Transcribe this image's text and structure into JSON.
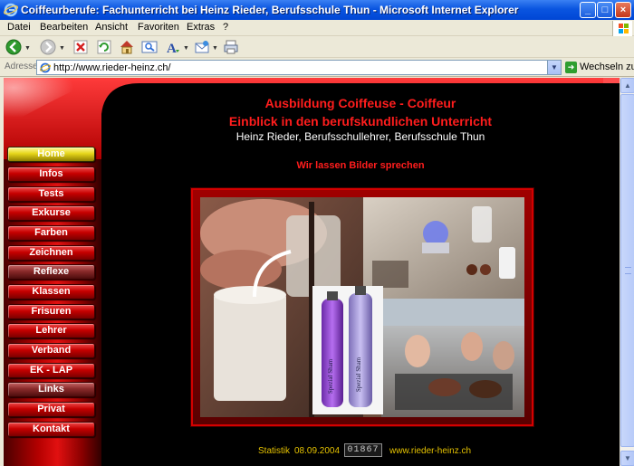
{
  "window": {
    "title": "Coiffeurberufe: Fachunterricht bei Heinz Rieder, Berufsschule Thun - Microsoft Internet Explorer",
    "minimize": "_",
    "maximize": "□",
    "close": "×"
  },
  "menu": [
    "Datei",
    "Bearbeiten",
    "Ansicht",
    "Favoriten",
    "Extras",
    "?"
  ],
  "address": {
    "label": "Adresse",
    "url": "http://www.rieder-heinz.ch/",
    "go_label": "Wechseln zu"
  },
  "header": {
    "line1": "Ausbildung Coiffeuse - Coiffeur",
    "line2": "Einblick in den berufskundlichen Unterricht",
    "line3": "Heinz Rieder,  Berufsschullehrer, Berufsschule Thun",
    "tagline": "Wir lassen Bilder sprechen"
  },
  "nav": [
    {
      "label": "Home"
    },
    {
      "label": "Infos"
    },
    {
      "label": "Tests"
    },
    {
      "label": "Exkurse"
    },
    {
      "label": "Farben"
    },
    {
      "label": "Zeichnen"
    },
    {
      "label": "Reflexe"
    },
    {
      "label": "Klassen"
    },
    {
      "label": "Frisuren"
    },
    {
      "label": "Lehrer"
    },
    {
      "label": "Verband"
    },
    {
      "label": "EK - LAP"
    },
    {
      "label": "Links"
    },
    {
      "label": "Privat"
    },
    {
      "label": "Kontakt"
    }
  ],
  "nav_active_index": 0,
  "photo": {
    "bottle_label_left": "Spezial Sham",
    "bottle_label_right": "Spezial Sham"
  },
  "footer": {
    "stat_label": "Statistik",
    "date": "08.09.2004",
    "counter": "01867",
    "site": "www.rieder-heinz.ch"
  },
  "colors": {
    "page_bg": "#000000",
    "accent_red": "#ff1d1d",
    "footer_yellow": "#e5c200",
    "xp_blue": "#0a55e0"
  }
}
